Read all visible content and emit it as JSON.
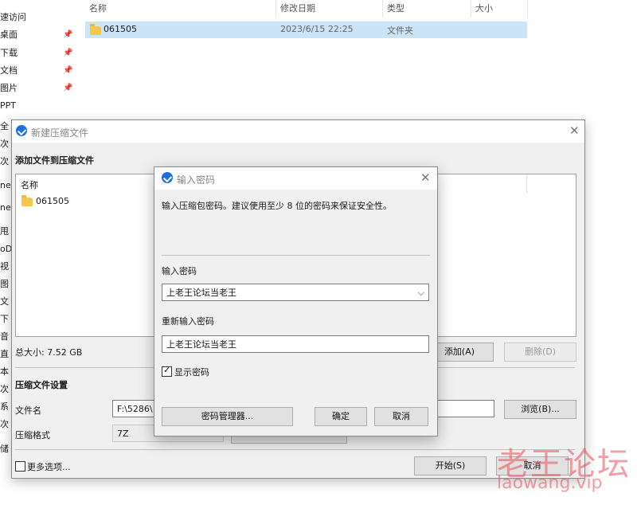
{
  "explorer": {
    "nav_items": [
      {
        "label": "速访问",
        "pinned": false
      },
      {
        "label": "桌面",
        "pinned": true
      },
      {
        "label": "下载",
        "pinned": true
      },
      {
        "label": "文档",
        "pinned": true
      },
      {
        "label": "图片",
        "pinned": true
      },
      {
        "label": "PPT",
        "pinned": false
      }
    ],
    "nav_fragments": [
      "全",
      "次",
      "次",
      "ne",
      "ne",
      "甩",
      "oD",
      "视",
      "图",
      "文",
      "下",
      "音",
      "直",
      "本",
      "次",
      "系",
      "次",
      "储"
    ],
    "columns": [
      "名称",
      "修改日期",
      "类型",
      "大小"
    ],
    "file": {
      "name": "061505",
      "date": "2023/6/15 22:25",
      "type": "文件夹",
      "size": ""
    }
  },
  "archive_dialog": {
    "title": "新建压缩文件",
    "section_add": "添加文件到压缩文件",
    "list_header": "名称",
    "list_item": "061505",
    "total_size": "总大小: 7.52 GB",
    "add_button": "添加(A)",
    "delete_button": "删除(D)",
    "settings_heading": "压缩文件设置",
    "filename_label": "文件名",
    "filename_value": "F:\\5286\\",
    "browse_button": "浏览(B)...",
    "format_label": "压缩格式",
    "format_value": "7Z",
    "more_options": "更多选项...",
    "start_button": "开始(S)",
    "cancel_button": "取消"
  },
  "password_dialog": {
    "title": "输入密码",
    "instruction": "输入压缩包密码。建议使用至少 8 位的密码来保证安全性。",
    "password_label": "输入密码",
    "password_value": "上老王论坛当老王",
    "repeat_label": "重新输入密码",
    "repeat_value": "上老王论坛当老王",
    "show_password": "显示密码",
    "show_password_checked": true,
    "manager_button": "密码管理器...",
    "ok_button": "确定",
    "cancel_button": "取消"
  },
  "watermark": {
    "line1": "老王论坛",
    "line2": "laowang.vip",
    "color": "#e8505b"
  },
  "colors": {
    "selection": "#cce4f7",
    "brand_blue": "#1e6fd9"
  }
}
